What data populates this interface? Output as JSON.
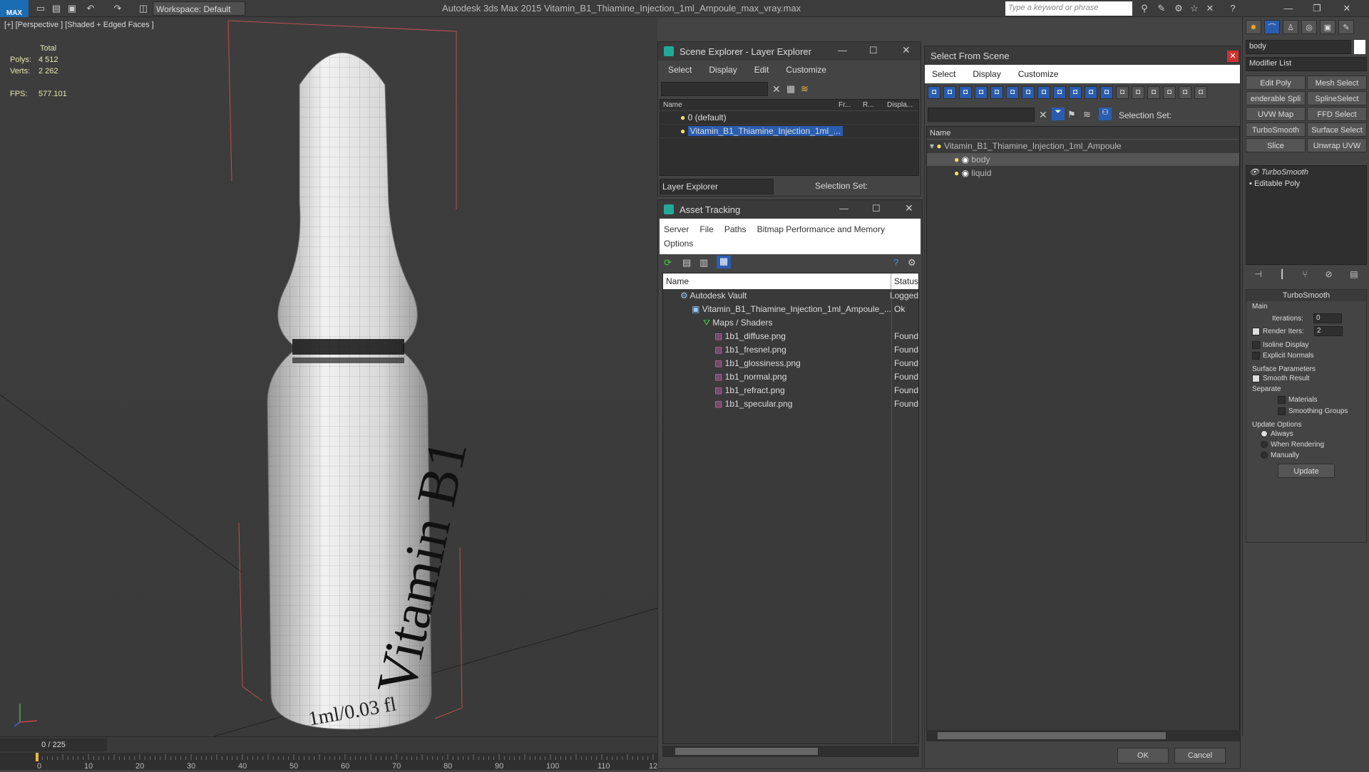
{
  "app": {
    "title": "Autodesk 3ds Max  2015      Vitamin_B1_Thiamine_Injection_1ml_Ampoule_max_vray.max",
    "workspace": "Workspace: Default",
    "search_placeholder": "Type a keyword or phrase",
    "logo": "MAX"
  },
  "viewport": {
    "label": "[+] [Perspective ] [Shaded + Edged Faces ]",
    "stats_header": "Total",
    "polys_label": "Polys:",
    "polys": "4 512",
    "verts_label": "Verts:",
    "verts": "2 262",
    "fps_label": "FPS:",
    "fps": "577.101",
    "product_text": "Vitamin B1",
    "volume_text": "1ml/0.03 fl"
  },
  "scene_explorer": {
    "title": "Scene Explorer - Layer Explorer",
    "menu": [
      "Select",
      "Display",
      "Edit",
      "Customize"
    ],
    "columns": [
      "Name",
      "Fr...",
      "R...",
      "Displa..."
    ],
    "rows": [
      "0 (default)",
      "Vitamin_B1_Thiamine_Injection_1ml_..."
    ],
    "footer_mode": "Layer Explorer",
    "selection_set": "Selection Set:"
  },
  "asset_tracking": {
    "title": "Asset Tracking",
    "menu": [
      "Server",
      "File",
      "Paths",
      "Bitmap Performance and Memory",
      "Options"
    ],
    "columns": [
      "Name",
      "Status"
    ],
    "rows": [
      {
        "name": "Autodesk Vault",
        "status": "Logged"
      },
      {
        "name": "Vitamin_B1_Thiamine_Injection_1ml_Ampoule_...",
        "status": "Ok"
      },
      {
        "name": "Maps / Shaders",
        "status": ""
      },
      {
        "name": "1b1_diffuse.png",
        "status": "Found"
      },
      {
        "name": "1b1_fresnel.png",
        "status": "Found"
      },
      {
        "name": "1b1_glossiness.png",
        "status": "Found"
      },
      {
        "name": "1b1_normal.png",
        "status": "Found"
      },
      {
        "name": "1b1_refract.png",
        "status": "Found"
      },
      {
        "name": "1b1_specular.png",
        "status": "Found"
      }
    ]
  },
  "select_from_scene": {
    "title": "Select From Scene",
    "menu": [
      "Select",
      "Display",
      "Customize"
    ],
    "selection_set": "Selection Set:",
    "column": "Name",
    "tree": [
      "Vitamin_B1_Thiamine_Injection_1ml_Ampoule",
      "body",
      "liquid"
    ],
    "ok": "OK",
    "cancel": "Cancel"
  },
  "command_panel": {
    "object_name": "body",
    "modifier_list": "Modifier List",
    "buttons": [
      "Edit Poly",
      "Mesh Select",
      "enderable Spli",
      "SplineSelect",
      "UVW Map",
      "FFD Select",
      "TurboSmooth",
      "Surface Select",
      "Slice",
      "Unwrap UVW"
    ],
    "stack": [
      "TurboSmooth",
      "Editable Poly"
    ],
    "rollout_title": "TurboSmooth",
    "main": "Main",
    "iterations_label": "Iterations:",
    "iterations": "0",
    "render_iters_label": "Render Iters:",
    "render_iters": "2",
    "isoline": "Isoline Display",
    "explicit": "Explicit Normals",
    "surface_params": "Surface Parameters",
    "smooth_result": "Smooth Result",
    "separate": "Separate",
    "materials": "Materials",
    "smoothing_groups": "Smoothing Groups",
    "update_options": "Update Options",
    "always": "Always",
    "when_rendering": "When Rendering",
    "manually": "Manually",
    "update": "Update"
  },
  "timeline": {
    "frame": "0 / 225",
    "ticks": [
      "0",
      "10",
      "20",
      "30",
      "40",
      "50",
      "60",
      "70",
      "80",
      "90",
      "100",
      "110",
      "12"
    ]
  }
}
